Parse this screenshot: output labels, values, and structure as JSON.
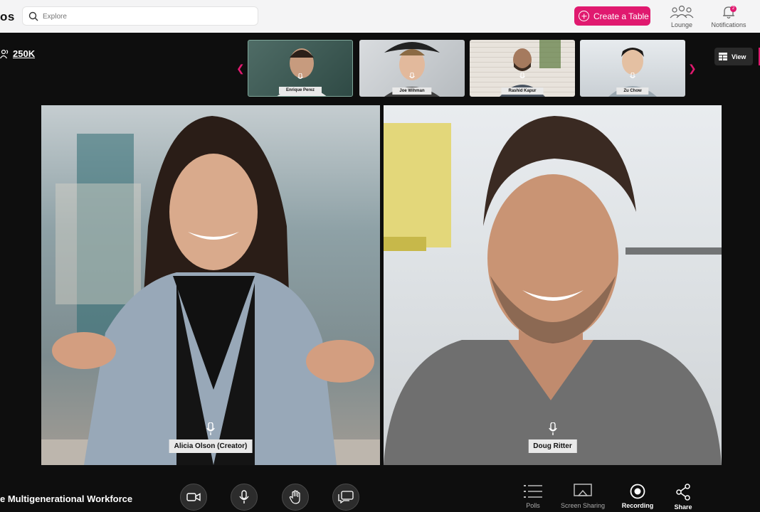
{
  "header": {
    "logo_text": "os",
    "search_placeholder": "Explore",
    "create_label": "Create a Table",
    "lounge_label": "Lounge",
    "notifications_label": "Notifications",
    "notifications_count": "2"
  },
  "participants": {
    "count": "250K"
  },
  "thumbnails": [
    {
      "name": "Enrique Perez"
    },
    {
      "name": "Joe Wihman"
    },
    {
      "name": "Rashid Kapur"
    },
    {
      "name": "Zu Chow"
    }
  ],
  "view_label": "View",
  "speakers": [
    {
      "name": "Alicia Olson (Creator)"
    },
    {
      "name": "Doug Ritter"
    }
  ],
  "session": {
    "title": "e Multigenerational Workforce"
  },
  "toolbar": {
    "polls": "Polls",
    "screen_sharing": "Screen Sharing",
    "recording": "Recording",
    "share": "Share"
  },
  "icons": [
    "search-icon",
    "plus-icon",
    "lounge-icon",
    "bell-icon",
    "people-icon",
    "chevron-left-icon",
    "chevron-right-icon",
    "grid-icon",
    "mic-icon",
    "video-camera-icon",
    "raise-hand-icon",
    "chat-icon",
    "polls-icon",
    "screen-share-icon",
    "record-icon",
    "share-icon"
  ],
  "colors": {
    "accent": "#e0196f",
    "background": "#0e0e0e",
    "topbar": "#f4f4f5"
  }
}
